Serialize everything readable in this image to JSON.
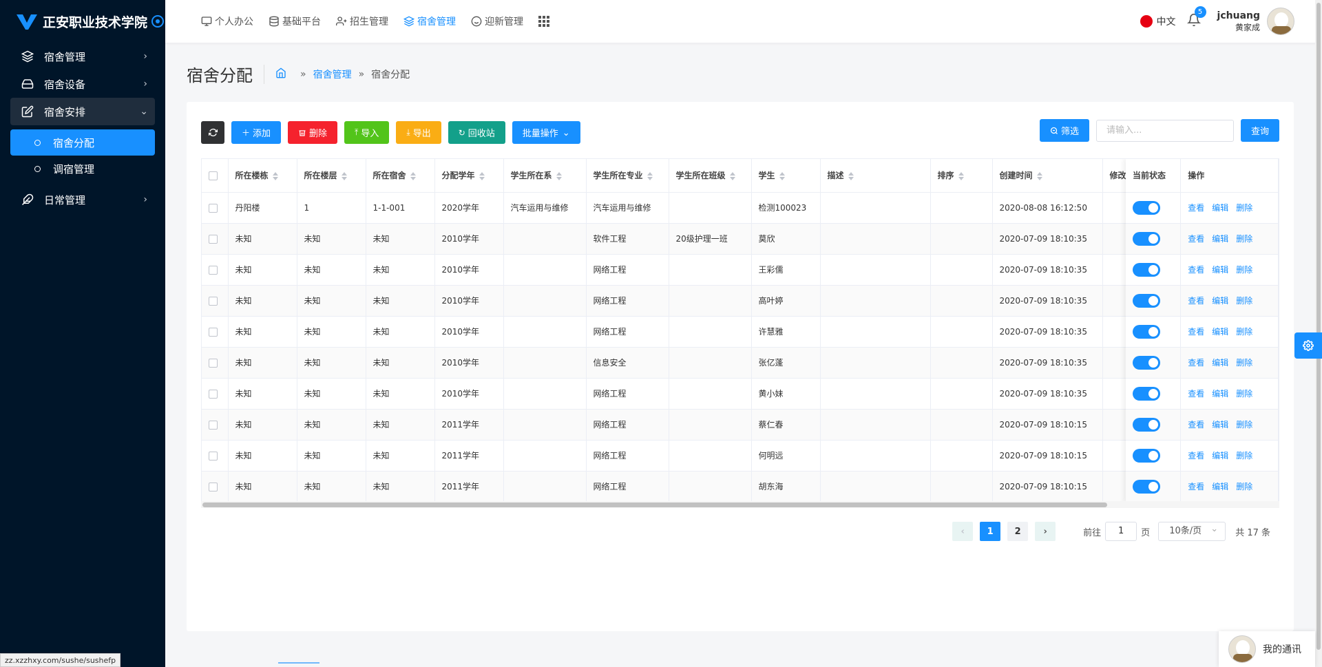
{
  "sidebar": {
    "logo_text": "正安职业技术学院",
    "items": [
      {
        "label": "宿舍管理",
        "icon": "layers-icon"
      },
      {
        "label": "宿舍设备",
        "icon": "drive-icon"
      },
      {
        "label": "宿舍安排",
        "icon": "edit-icon",
        "children": [
          {
            "label": "宿舍分配",
            "active": true
          },
          {
            "label": "调宿管理",
            "active": false
          }
        ]
      },
      {
        "label": "日常管理",
        "icon": "feather-icon"
      }
    ],
    "url_hint": "zz.xzzhxy.com/sushe/sushefp"
  },
  "topnav": {
    "items": [
      {
        "label": "个人办公",
        "icon": "monitor-icon"
      },
      {
        "label": "基础平台",
        "icon": "database-icon"
      },
      {
        "label": "招生管理",
        "icon": "user-plus-icon"
      },
      {
        "label": "宿舍管理",
        "icon": "layers-icon",
        "active": true
      },
      {
        "label": "迎新管理",
        "icon": "smile-icon"
      }
    ],
    "lang": "中文",
    "notification_count": "5",
    "username": "jchuang",
    "realname": "黄家成"
  },
  "page": {
    "title": "宿舍分配",
    "breadcrumb": [
      "宿舍管理",
      "宿舍分配"
    ]
  },
  "toolbar": {
    "add": "添加",
    "delete": "删除",
    "import": "导入",
    "export": "导出",
    "recycle": "回收站",
    "batch": "批量操作",
    "filter": "筛选",
    "search_placeholder": "请输入...",
    "query": "查询"
  },
  "table": {
    "columns": [
      "所在楼栋",
      "所在楼层",
      "所在宿舍",
      "分配学年",
      "学生所在系",
      "学生所在专业",
      "学生所在班级",
      "学生",
      "描述",
      "排序",
      "创建时间",
      "修改"
    ],
    "fixed_columns": [
      "当前状态",
      "操作"
    ],
    "actions": [
      "查看",
      "编辑",
      "删除"
    ],
    "rows": [
      [
        "丹阳楼",
        "1",
        "1-1-001",
        "2020学年",
        "汽车运用与维修",
        "汽车运用与维修",
        "",
        "检测100023",
        "",
        "",
        "2020-08-08 16:12:50"
      ],
      [
        "未知",
        "未知",
        "未知",
        "2010学年",
        "",
        "软件工程",
        "20级护理一班",
        "莫欣",
        "",
        "",
        "2020-07-09 18:10:35"
      ],
      [
        "未知",
        "未知",
        "未知",
        "2010学年",
        "",
        "网络工程",
        "",
        "王彩儒",
        "",
        "",
        "2020-07-09 18:10:35"
      ],
      [
        "未知",
        "未知",
        "未知",
        "2010学年",
        "",
        "网络工程",
        "",
        "高叶婷",
        "",
        "",
        "2020-07-09 18:10:35"
      ],
      [
        "未知",
        "未知",
        "未知",
        "2010学年",
        "",
        "网络工程",
        "",
        "许慧雅",
        "",
        "",
        "2020-07-09 18:10:35"
      ],
      [
        "未知",
        "未知",
        "未知",
        "2010学年",
        "",
        "信息安全",
        "",
        "张亿蓬",
        "",
        "",
        "2020-07-09 18:10:35"
      ],
      [
        "未知",
        "未知",
        "未知",
        "2010学年",
        "",
        "网络工程",
        "",
        "黄小妹",
        "",
        "",
        "2020-07-09 18:10:35"
      ],
      [
        "未知",
        "未知",
        "未知",
        "2011学年",
        "",
        "网络工程",
        "",
        "蔡仁春",
        "",
        "",
        "2020-07-09 18:10:15"
      ],
      [
        "未知",
        "未知",
        "未知",
        "2011学年",
        "",
        "网络工程",
        "",
        "何明远",
        "",
        "",
        "2020-07-09 18:10:15"
      ],
      [
        "未知",
        "未知",
        "未知",
        "2011学年",
        "",
        "网络工程",
        "",
        "胡东海",
        "",
        "",
        "2020-07-09 18:10:15"
      ]
    ]
  },
  "pagination": {
    "pages": [
      "1",
      "2"
    ],
    "current": "1",
    "goto_label": "前往",
    "goto_value": "1",
    "page_label": "页",
    "page_size": "10条/页",
    "total": "共 17 条"
  },
  "chat": {
    "label": "我的通讯"
  },
  "colors": {
    "primary": "#1890ff",
    "sidebar": "#001529",
    "danger": "#f5222d",
    "success": "#52c41a",
    "warning": "#faad14",
    "teal": "#13a08a"
  }
}
